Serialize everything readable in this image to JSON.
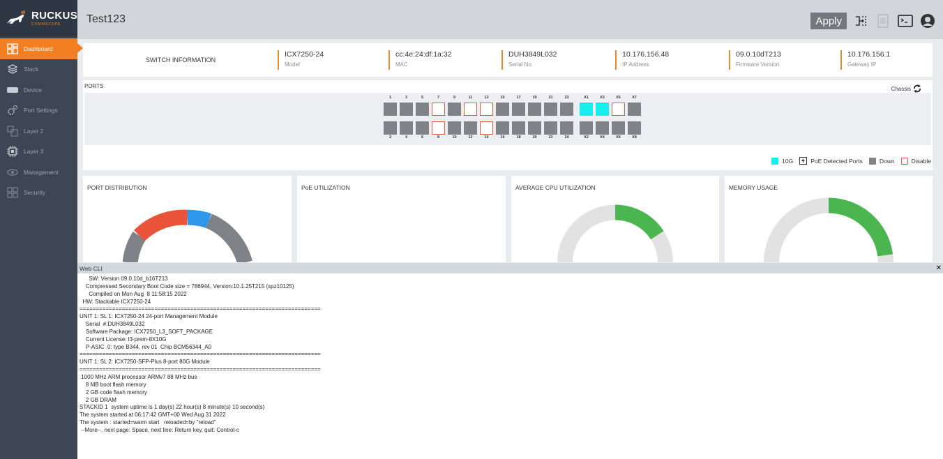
{
  "sidebar": {
    "logo": {
      "text": "RUCKUS",
      "subtext": "COMMSCOPE"
    },
    "items": [
      {
        "label": "Dashboard",
        "icon": "dashboard-icon",
        "active": true
      },
      {
        "label": "Stack",
        "icon": "stack-icon"
      },
      {
        "label": "Device",
        "icon": "device-icon"
      },
      {
        "label": "Port Settings",
        "icon": "port-settings-icon"
      },
      {
        "label": "Layer 2",
        "icon": "layer2-icon"
      },
      {
        "label": "Layer 3",
        "icon": "layer3-icon"
      },
      {
        "label": "Management",
        "icon": "management-icon"
      },
      {
        "label": "Security",
        "icon": "security-icon"
      }
    ]
  },
  "header": {
    "title": "Test123",
    "apply_label": "Apply"
  },
  "switch_info": {
    "label": "SWITCH INFORMATION",
    "fields": [
      {
        "value": "ICX7250-24",
        "caption": "Model"
      },
      {
        "value": "cc:4e:24:df:1a:32",
        "caption": "MAC"
      },
      {
        "value": "DUH3849L032",
        "caption": "Serial No"
      },
      {
        "value": "10.176.156.48",
        "caption": "IP Address"
      },
      {
        "value": "09.0.10dT213",
        "caption": "Firmware Version"
      },
      {
        "value": "10.176.156.1",
        "caption": "Gateway IP"
      }
    ]
  },
  "ports": {
    "title": "PORTS",
    "chassis_label": "Chassis",
    "top_row": [
      "1",
      "3",
      "5",
      "7",
      "9",
      "11",
      "13",
      "15",
      "17",
      "19",
      "21",
      "23"
    ],
    "bottom_row": [
      "2",
      "4",
      "6",
      "8",
      "10",
      "12",
      "14",
      "16",
      "18",
      "20",
      "22",
      "24"
    ],
    "x_top": [
      "X1",
      "X3",
      "X5",
      "X7"
    ],
    "x_bottom": [
      "X2",
      "X4",
      "X6",
      "X8"
    ],
    "disabled": [
      "7",
      "8",
      "11",
      "13",
      "14",
      "X5"
    ],
    "ten_g": [
      "X1",
      "X3"
    ],
    "legend": {
      "ten_g": "10G",
      "poe": "PoE Detected Ports",
      "down": "Down",
      "disable": "Disable"
    },
    "colors": {
      "down": "#7f8287",
      "ten_g": "#18eeee",
      "disable": "#e35a3c"
    }
  },
  "widgets": {
    "port_distribution": "PORT DISTRIBUTION",
    "poe_utilization": "PoE UTILIZATION",
    "avg_cpu": "AVERAGE CPU UTILIZATION",
    "memory": "MEMORY USAGE"
  },
  "cli": {
    "title": "Web CLI",
    "close": "×",
    "lines": [
      "      SW: Version 09.0.10d_b16T213",
      "    Compressed Secondary Boot Code size = 786944, Version:10.1.25T215 (spz10125)",
      "      Compiled on Mon Aug  8 11:58:15 2022",
      "  HW: Stackable ICX7250-24",
      "==========================================================================",
      "UNIT 1: SL 1: ICX7250-24 24-port Management Module",
      "    Serial  #:DUH3849L032",
      "    Software Package: ICX7250_L3_SOFT_PACKAGE",
      "    Current License: l3-prem-8X10G",
      "    P-ASIC  0: type B344, rev 01  Chip BCM56344_A0",
      "==========================================================================",
      "UNIT 1: SL 2: ICX7250-SFP-Plus 8-port 80G Module",
      "==========================================================================",
      " 1000 MHz ARM processor ARMv7 88 MHz bus",
      "    8 MB boot flash memory",
      "    2 GB code flash memory",
      "    2 GB DRAM",
      "STACKID 1  system uptime is 1 day(s) 22 hour(s) 8 minute(s) 10 second(s)",
      "The system started at 06:17:42 GMT+00 Wed Aug 31 2022",
      "The system : started=warm start   reloaded=by \"reload\"",
      " --More--, next page: Space, next line: Return key, quit: Control-c"
    ]
  }
}
